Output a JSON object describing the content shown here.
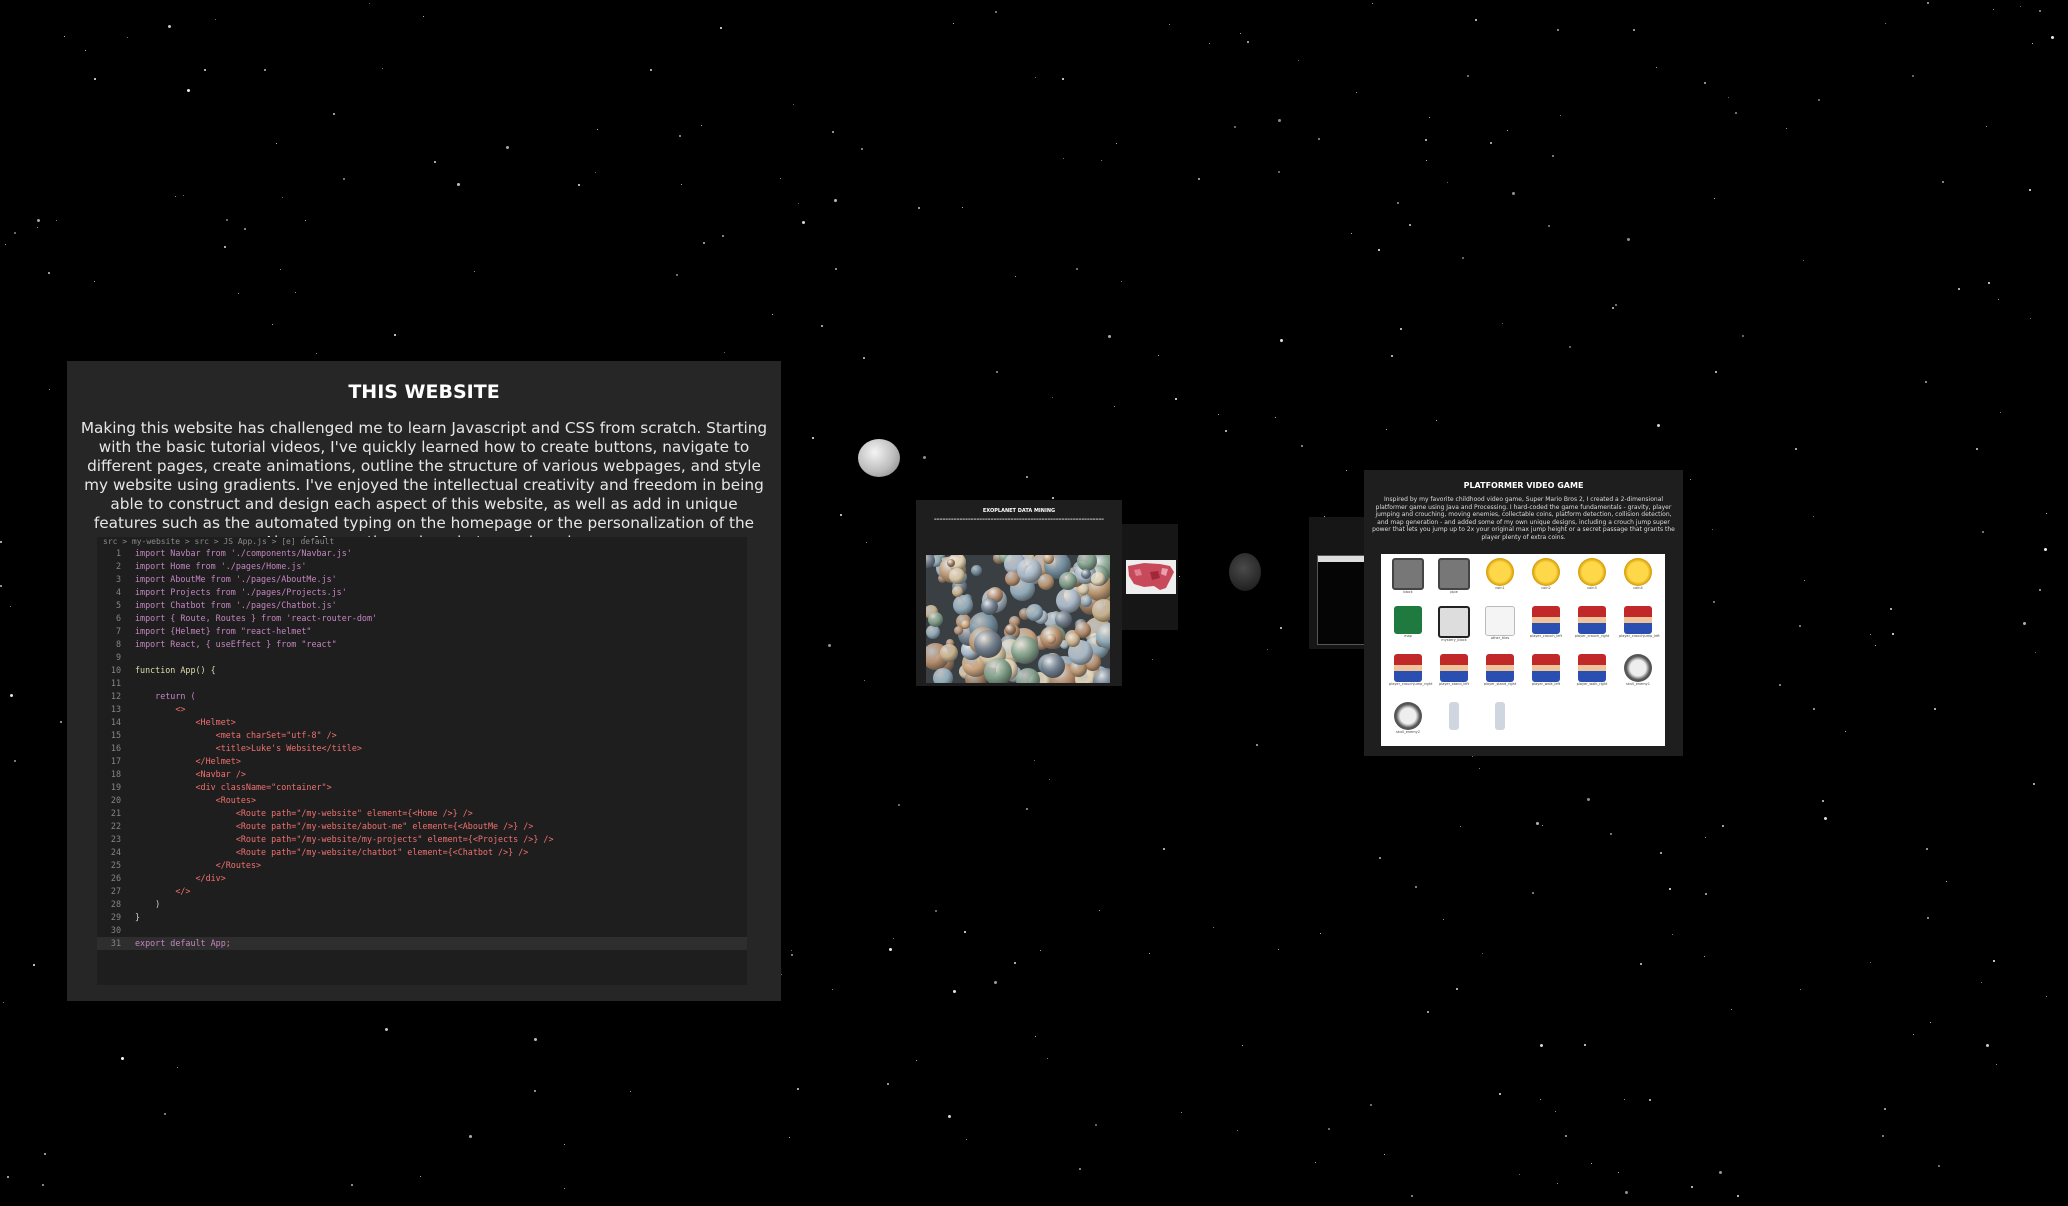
{
  "main_card": {
    "title": "THIS WEBSITE",
    "description": "Making this website has challenged me to learn Javascript and CSS from scratch. Starting with the basic tutorial videos, I've quickly learned how to create buttons, navigate to different pages, create animations, outline the structure of various webpages, and style my website using gradients. I've enjoyed the intellectual creativity and freedom in being able to construct and design each aspect of this website, as well as add in unique features such as the automated typing on the homepage or the personalization of the About Me section using photos and cards.",
    "code_breadcrumb": "src > my-website > src > JS App.js > [e] default",
    "code_lines": [
      {
        "n": "1",
        "code": "import Navbar from './components/Navbar.js'"
      },
      {
        "n": "2",
        "code": "import Home from './pages/Home.js'"
      },
      {
        "n": "3",
        "code": "import AboutMe from './pages/AboutMe.js'"
      },
      {
        "n": "4",
        "code": "import Projects from './pages/Projects.js'"
      },
      {
        "n": "5",
        "code": "import Chatbot from './pages/Chatbot.js'"
      },
      {
        "n": "6",
        "code": "import { Route, Routes } from 'react-router-dom'"
      },
      {
        "n": "7",
        "code": "import {Helmet} from \"react-helmet\""
      },
      {
        "n": "8",
        "code": "import React, { useEffect } from \"react\""
      },
      {
        "n": "9",
        "code": ""
      },
      {
        "n": "10",
        "code": "function App() {"
      },
      {
        "n": "11",
        "code": ""
      },
      {
        "n": "12",
        "code": "    return ("
      },
      {
        "n": "13",
        "code": "        <>"
      },
      {
        "n": "14",
        "code": "            <Helmet>"
      },
      {
        "n": "15",
        "code": "                <meta charSet=\"utf-8\" />"
      },
      {
        "n": "16",
        "code": "                <title>Luke's Website</title>"
      },
      {
        "n": "17",
        "code": "            </Helmet>"
      },
      {
        "n": "18",
        "code": "            <Navbar />"
      },
      {
        "n": "19",
        "code": "            <div className=\"container\">"
      },
      {
        "n": "20",
        "code": "                <Routes>"
      },
      {
        "n": "21",
        "code": "                    <Route path=\"/my-website\" element={<Home />} />"
      },
      {
        "n": "22",
        "code": "                    <Route path=\"/my-website/about-me\" element={<AboutMe />} />"
      },
      {
        "n": "23",
        "code": "                    <Route path=\"/my-website/my-projects\" element={<Projects />} />"
      },
      {
        "n": "24",
        "code": "                    <Route path=\"/my-website/chatbot\" element={<Chatbot />} />"
      },
      {
        "n": "25",
        "code": "                </Routes>"
      },
      {
        "n": "26",
        "code": "            </div>"
      },
      {
        "n": "27",
        "code": "        </>"
      },
      {
        "n": "28",
        "code": "    )"
      },
      {
        "n": "29",
        "code": "}"
      },
      {
        "n": "30",
        "code": ""
      },
      {
        "n": "31",
        "code": "export default App;"
      }
    ]
  },
  "exoplanet_card": {
    "title": "EXOPLANET DATA MINING"
  },
  "platformer_card": {
    "title": "PLATFORMER VIDEO GAME",
    "description": "Inspired by my favorite childhood video game, Super Mario Bros 2, I created a 2-dimensional platformer game using Java and Processing. I hard-coded the game fundamentals - gravity, player jumping and crouching, moving enemies, collectable coins, platform detection, collision detection, and map generation - and added some of my own unique designs, including a crouch jump super power that lets you jump up to 2x your original max jump height or a secret passage that grants the player plenty of extra coins.",
    "sprites": [
      {
        "label": "block",
        "kind": "block"
      },
      {
        "label": "pipe",
        "kind": "block"
      },
      {
        "label": "coin1",
        "kind": "coin"
      },
      {
        "label": "coin2",
        "kind": "coin"
      },
      {
        "label": "coin3",
        "kind": "coin"
      },
      {
        "label": "coin4",
        "kind": "coin"
      },
      {
        "label": "map",
        "kind": "excel"
      },
      {
        "label": "mystery_block",
        "kind": "mystery"
      },
      {
        "label": "other_tiles",
        "kind": "file"
      },
      {
        "label": "player_crouch_left",
        "kind": "mario"
      },
      {
        "label": "player_crouch_right",
        "kind": "mario"
      },
      {
        "label": "player_crouchjump_left",
        "kind": "mario"
      },
      {
        "label": "player_crouchjump_right",
        "kind": "mario"
      },
      {
        "label": "player_stand_left",
        "kind": "mario"
      },
      {
        "label": "player_stand_right",
        "kind": "mario"
      },
      {
        "label": "player_walk_left",
        "kind": "mario"
      },
      {
        "label": "player_walk_right",
        "kind": "mario"
      },
      {
        "label": "skull_enemy1",
        "kind": "skull"
      },
      {
        "label": "skull_enemy2",
        "kind": "skull"
      },
      {
        "label": "",
        "kind": "small"
      },
      {
        "label": "",
        "kind": "small"
      }
    ]
  },
  "colors": {
    "background": "#000000",
    "card": "#262626",
    "code_bg": "#1e1e1e"
  }
}
